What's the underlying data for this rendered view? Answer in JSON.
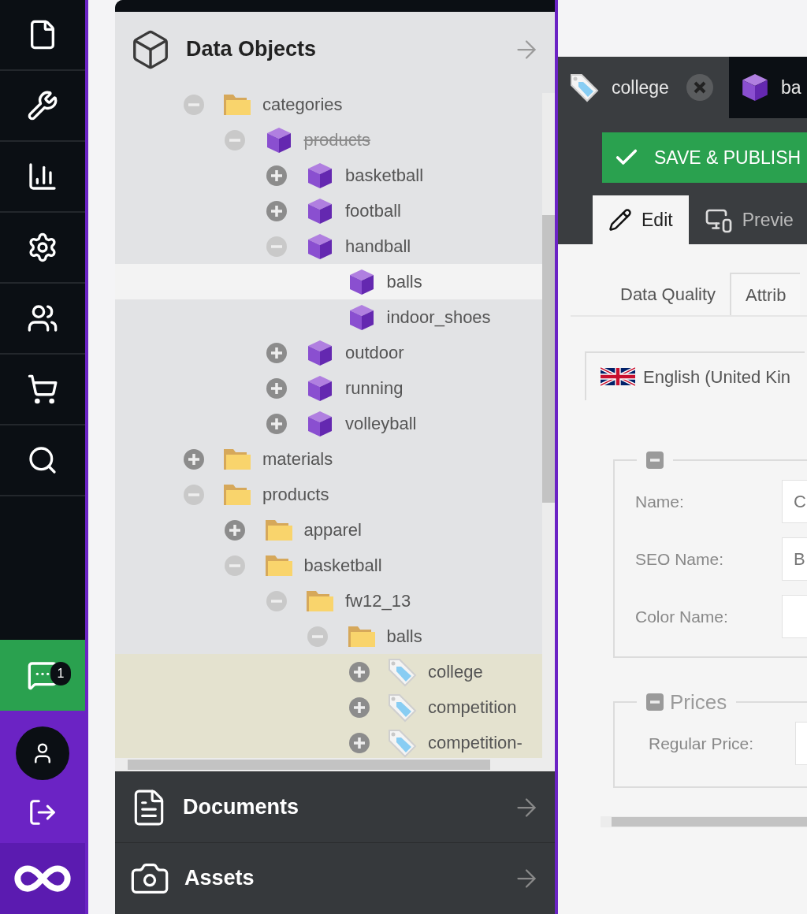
{
  "sidebar": {
    "notification_count": "1"
  },
  "panels": [
    {
      "kind": "objects",
      "title": "Data Objects",
      "expanded": true
    },
    {
      "kind": "documents",
      "title": "Documents",
      "expanded": false
    },
    {
      "kind": "assets",
      "title": "Assets",
      "expanded": false
    }
  ],
  "tree": [
    {
      "label": "categories",
      "kind": "folder",
      "expanded": true,
      "selected": false,
      "highlighted": false,
      "unpublished": false,
      "children": [
        {
          "label": "products",
          "kind": "object",
          "expanded": true,
          "selected": false,
          "highlighted": false,
          "unpublished": true,
          "children": [
            {
              "label": "basketball",
              "kind": "object",
              "expanded": false,
              "selected": false,
              "highlighted": false,
              "unpublished": false
            },
            {
              "label": "football",
              "kind": "object",
              "expanded": false,
              "selected": false,
              "highlighted": false,
              "unpublished": false
            },
            {
              "label": "handball",
              "kind": "object",
              "expanded": true,
              "selected": false,
              "highlighted": false,
              "unpublished": false,
              "children": [
                {
                  "label": "balls",
                  "kind": "object",
                  "selected": true,
                  "highlighted": false,
                  "unpublished": false
                },
                {
                  "label": "indoor_shoes",
                  "kind": "object",
                  "selected": false,
                  "highlighted": false,
                  "unpublished": false
                }
              ]
            },
            {
              "label": "outdoor",
              "kind": "object",
              "expanded": false,
              "selected": false,
              "highlighted": false,
              "unpublished": false
            },
            {
              "label": "running",
              "kind": "object",
              "expanded": false,
              "selected": false,
              "highlighted": false,
              "unpublished": false
            },
            {
              "label": "volleyball",
              "kind": "object",
              "expanded": false,
              "selected": false,
              "highlighted": false,
              "unpublished": false
            }
          ]
        }
      ]
    },
    {
      "label": "materials",
      "kind": "folder",
      "expanded": false,
      "selected": false,
      "highlighted": false,
      "unpublished": false
    },
    {
      "label": "products",
      "kind": "folder",
      "expanded": true,
      "selected": false,
      "highlighted": false,
      "unpublished": false,
      "children": [
        {
          "label": "apparel",
          "kind": "folder",
          "expanded": false,
          "selected": false,
          "highlighted": false,
          "unpublished": false
        },
        {
          "label": "basketball",
          "kind": "folder",
          "expanded": true,
          "selected": false,
          "highlighted": false,
          "unpublished": false,
          "children": [
            {
              "label": "fw12_13",
              "kind": "folder",
              "expanded": true,
              "selected": false,
              "highlighted": false,
              "unpublished": false,
              "children": [
                {
                  "label": "balls",
                  "kind": "folder",
                  "expanded": true,
                  "selected": false,
                  "highlighted": false,
                  "unpublished": false,
                  "children": [
                    {
                      "label": "college",
                      "kind": "variant",
                      "expanded": false,
                      "selected": false,
                      "highlighted": true,
                      "unpublished": false
                    },
                    {
                      "label": "competition",
                      "kind": "variant",
                      "expanded": false,
                      "selected": false,
                      "highlighted": true,
                      "unpublished": false
                    },
                    {
                      "label": "competition-",
                      "kind": "variant",
                      "expanded": false,
                      "selected": false,
                      "highlighted": true,
                      "unpublished": false
                    }
                  ]
                }
              ]
            }
          ]
        }
      ]
    }
  ],
  "editor": {
    "tabs": [
      {
        "kind": "variant",
        "label": "college",
        "selected": true,
        "closable": true
      },
      {
        "kind": "object",
        "label": "ba",
        "selected": false,
        "closable": false
      }
    ],
    "save_button": "SAVE & PUBLISH",
    "view_tabs": [
      {
        "kind": "edit",
        "label": "Edit",
        "selected": true
      },
      {
        "kind": "preview",
        "label": "Previe",
        "selected": false
      }
    ],
    "sub_tabs": [
      {
        "label": "Data Quality",
        "selected": false
      },
      {
        "label": "Attrib",
        "selected": true
      }
    ],
    "language_tabs": [
      {
        "label": "English (United Kin",
        "selected": true
      }
    ],
    "fieldsets": [
      {
        "fields": [
          {
            "label": "Name:",
            "value": "C"
          },
          {
            "label": "SEO Name:",
            "value": "B"
          },
          {
            "label": "Color Name:"
          }
        ]
      },
      {
        "title": "Prices",
        "fields": [
          {
            "label": "Regular Price:"
          }
        ]
      }
    ]
  }
}
